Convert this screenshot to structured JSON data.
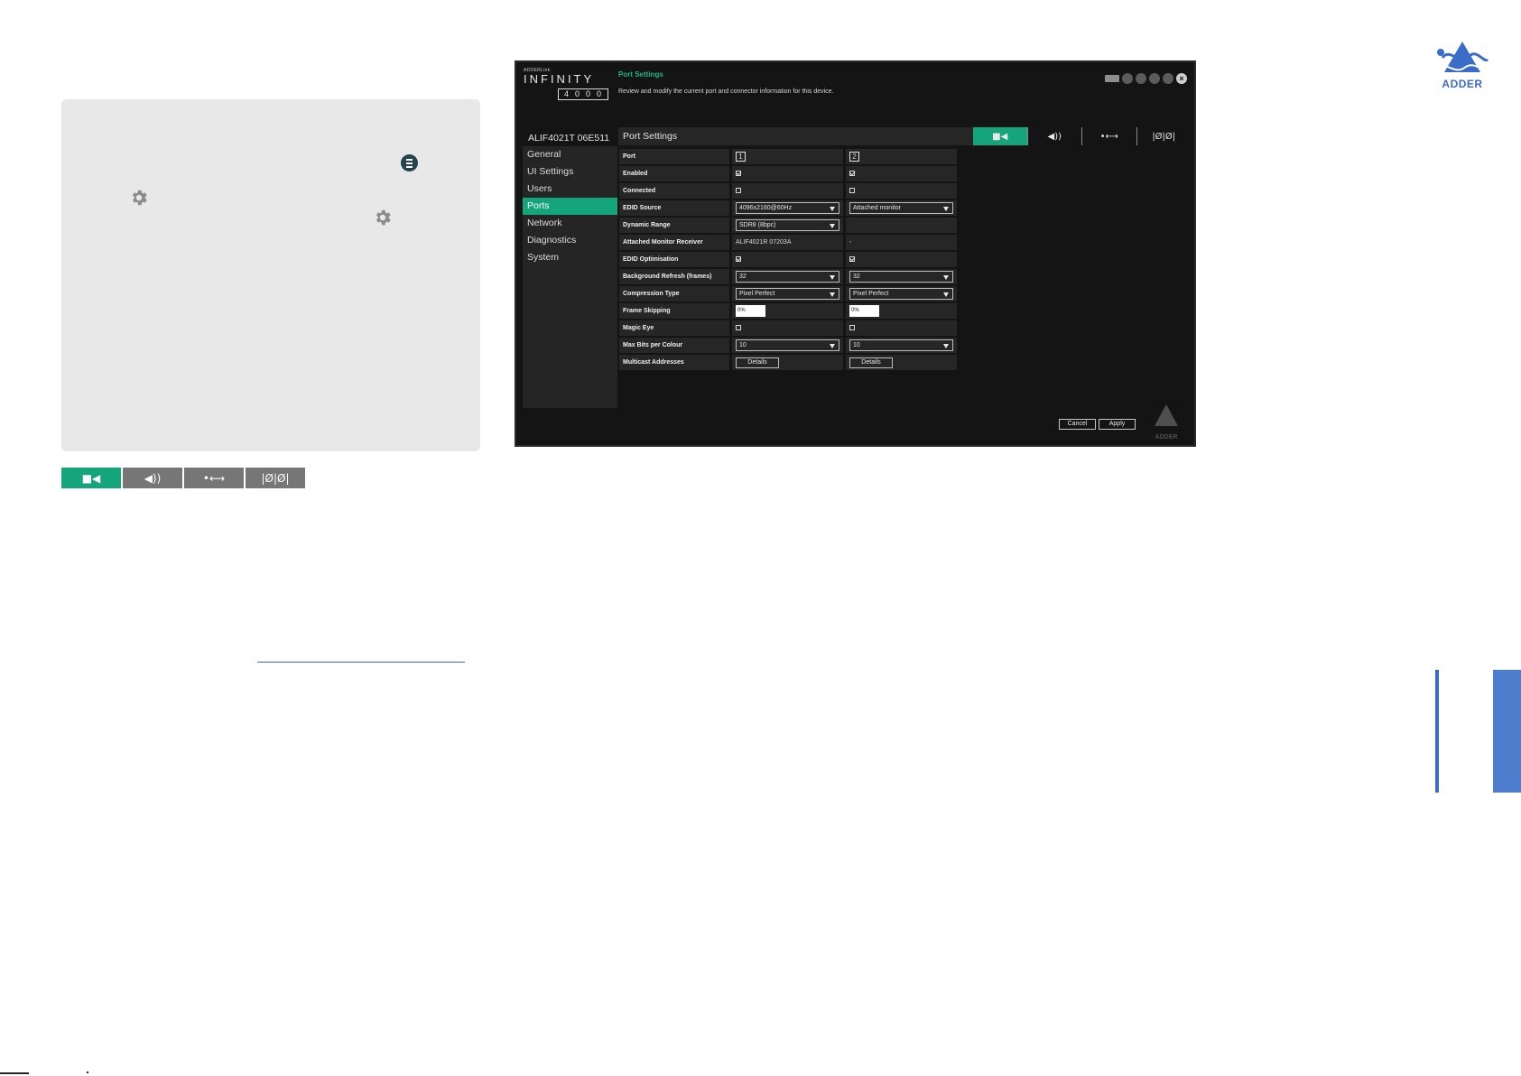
{
  "app": {
    "brand_small": "ADDERLink",
    "brand_name": "INFINITY",
    "brand_model": "4000",
    "page_title": "Port Settings",
    "page_description": "Review and modify the current port and connector information for this device.",
    "device_name": "ALIF4021T 06E511"
  },
  "sidebar": {
    "items": [
      {
        "label": "General"
      },
      {
        "label": "UI Settings"
      },
      {
        "label": "Users"
      },
      {
        "label": "Ports"
      },
      {
        "label": "Network"
      },
      {
        "label": "Diagnostics"
      },
      {
        "label": "System"
      }
    ],
    "active": "Ports"
  },
  "content": {
    "header": "Port Settings",
    "tabs": [
      {
        "icon": "video-icon",
        "glyph": "■◀"
      },
      {
        "icon": "audio-icon",
        "glyph": "◀))"
      },
      {
        "icon": "usb-icon",
        "glyph": "•⟷"
      },
      {
        "icon": "serial-icon",
        "glyph": "|Ø|Ø|"
      }
    ],
    "rows": {
      "port": {
        "label": "Port",
        "p1": "1",
        "p2": "2"
      },
      "enabled": {
        "label": "Enabled",
        "p1": true,
        "p2": true
      },
      "connected": {
        "label": "Connected",
        "p1": false,
        "p2": false
      },
      "edid_source": {
        "label": "EDID Source",
        "p1": "4096x2160@60Hz",
        "p2": "Attached monitor"
      },
      "dynamic_range": {
        "label": "Dynamic Range",
        "p1": "SDR8 (8bpc)",
        "p2": ""
      },
      "attached_monitor_receiver": {
        "label": "Attached Monitor Receiver",
        "p1": "ALIF4021R 07203A",
        "p2": "-"
      },
      "edid_optimisation": {
        "label": "EDID Optimisation",
        "p1": true,
        "p2": true
      },
      "background_refresh": {
        "label": "Background Refresh (frames)",
        "p1": "32",
        "p2": "32"
      },
      "compression_type": {
        "label": "Compression Type",
        "p1": "Pixel Perfect",
        "p2": "Pixel Perfect"
      },
      "frame_skipping": {
        "label": "Frame Skipping",
        "p1": "0%",
        "p2": "0%"
      },
      "magic_eye": {
        "label": "Magic Eye",
        "p1": false,
        "p2": false
      },
      "max_bits": {
        "label": "Max Bits per Colour",
        "p1": "10",
        "p2": "10"
      },
      "multicast": {
        "label": "Multicast Addresses",
        "p1": "Details",
        "p2": "Details"
      }
    }
  },
  "footer": {
    "cancel": "Cancel",
    "apply": "Apply"
  },
  "watermark": "ADDER",
  "page": {
    "logo_word": "ADDER",
    "mini_tabs": [
      {
        "icon": "video-icon",
        "glyph": "■◀"
      },
      {
        "icon": "audio-icon",
        "glyph": "◀))"
      },
      {
        "icon": "usb-icon",
        "glyph": "•⟷"
      },
      {
        "icon": "serial-icon",
        "glyph": "|Ø|Ø|"
      }
    ]
  },
  "colors": {
    "accent": "#14a57b",
    "brand_blue": "#3b6cc8",
    "panel": "#e8e8e8",
    "dark_bg": "#141414"
  }
}
